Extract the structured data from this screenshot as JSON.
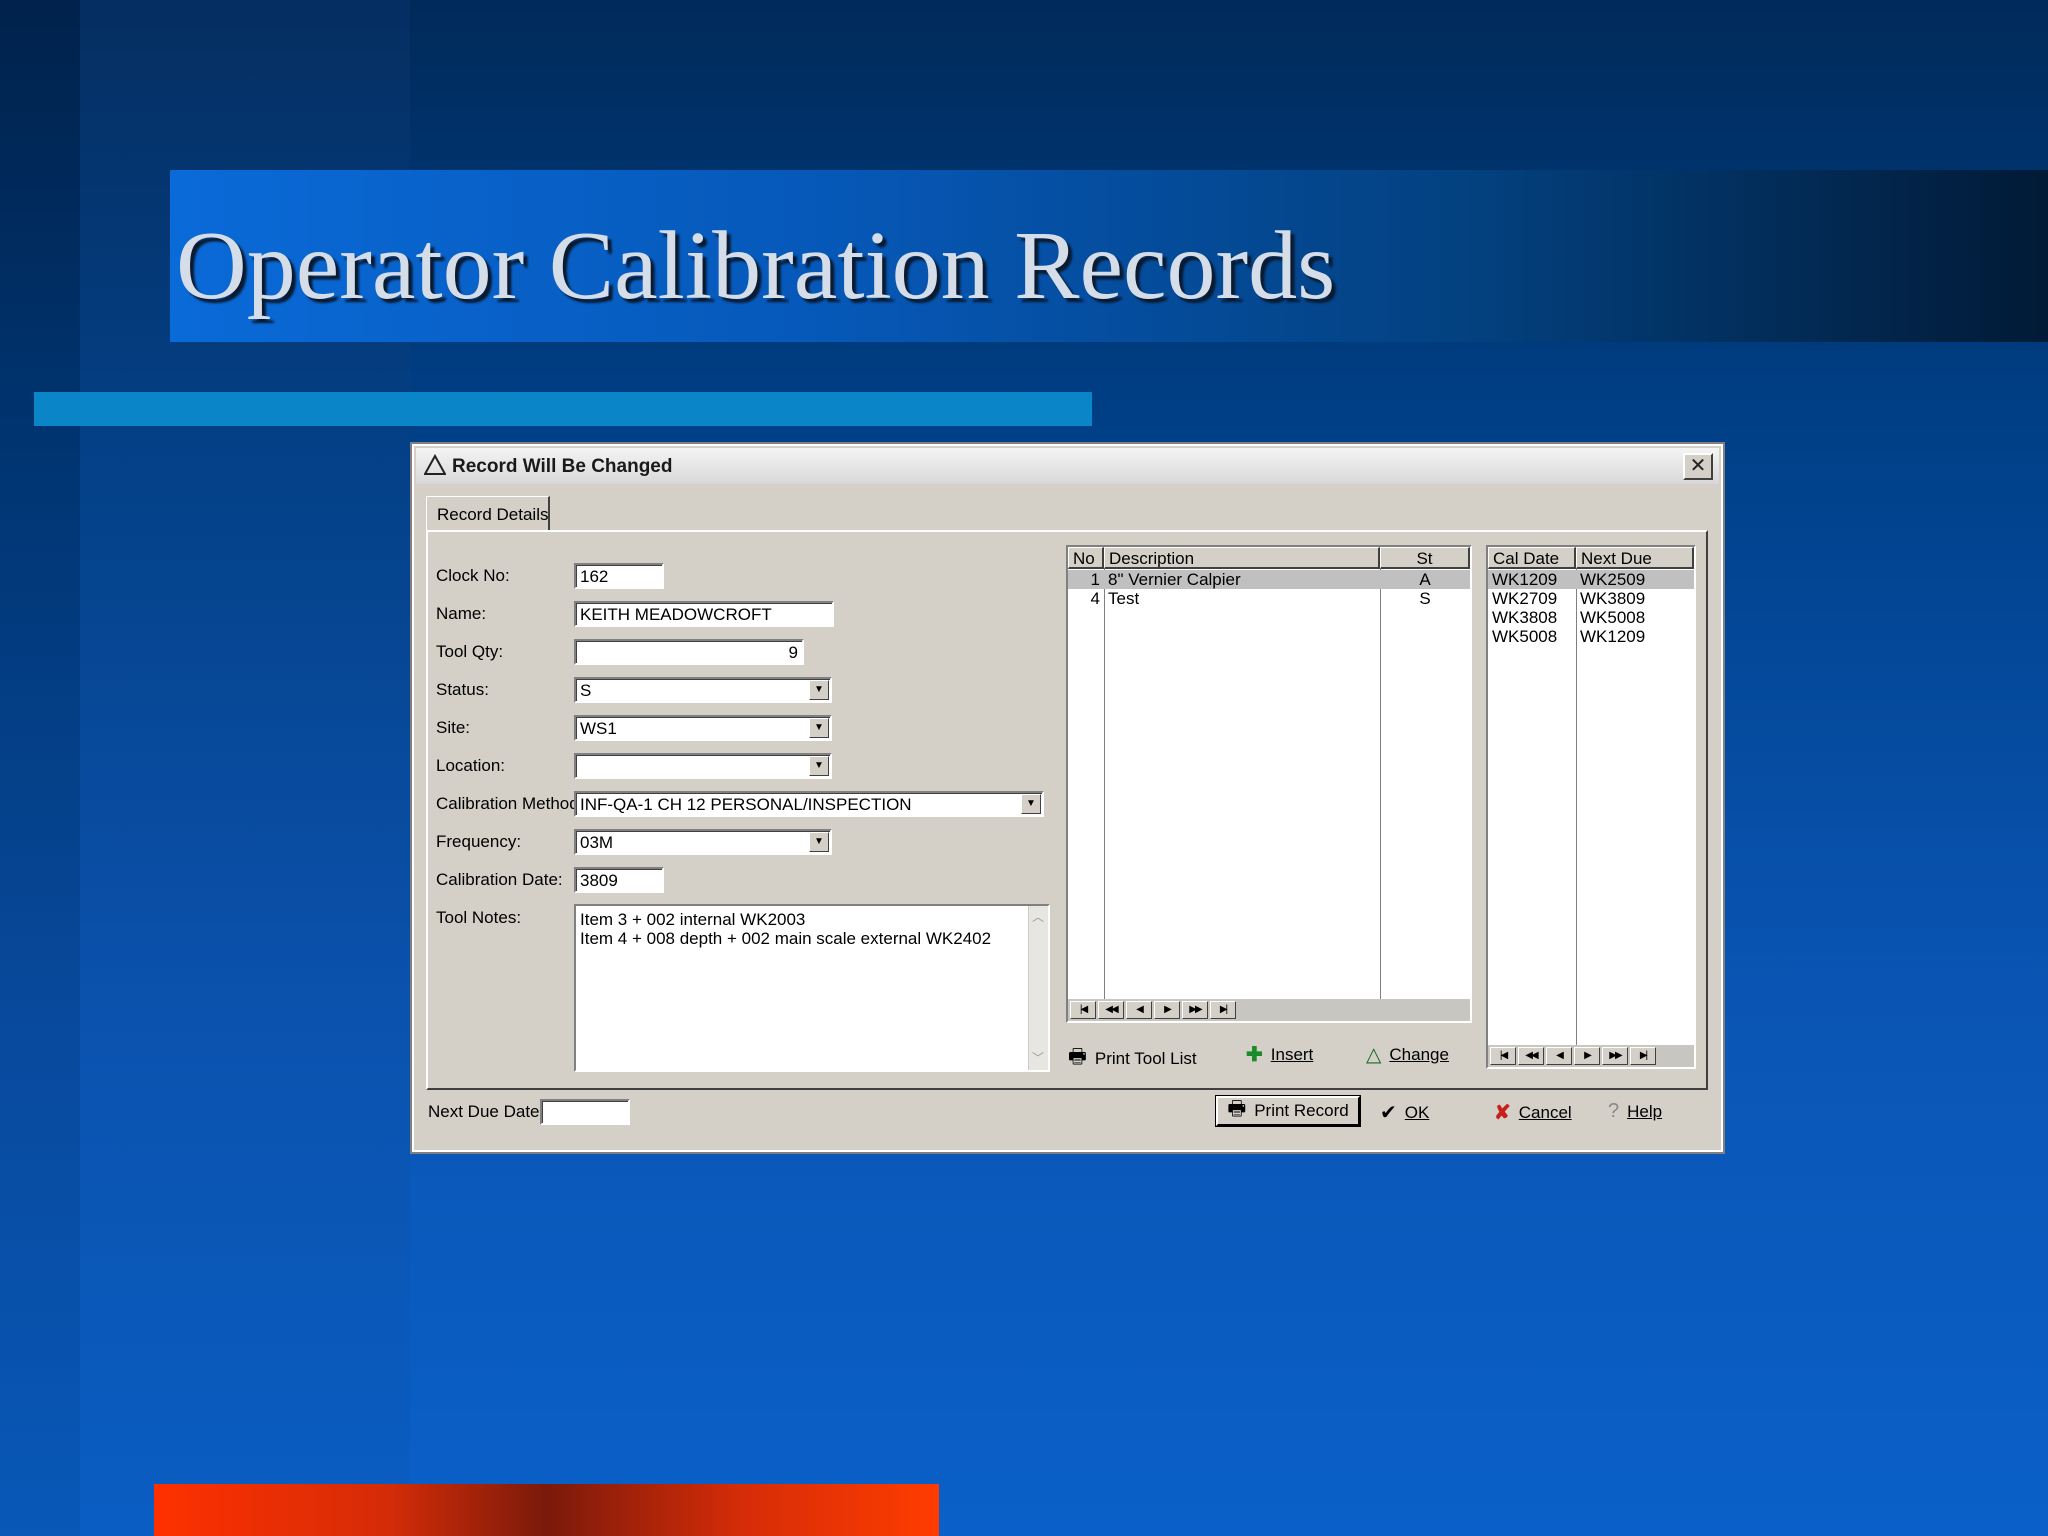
{
  "slide": {
    "title": "Operator Calibration Records"
  },
  "dialog": {
    "title": "Record Will Be Changed",
    "tab_label": "Record Details",
    "fields": {
      "clock_no": {
        "label": "Clock No:",
        "value": "162"
      },
      "name": {
        "label": "Name:",
        "value": "KEITH MEADOWCROFT"
      },
      "tool_qty": {
        "label": "Tool Qty:",
        "value": "9"
      },
      "status": {
        "label": "Status:",
        "value": "S"
      },
      "site": {
        "label": "Site:",
        "value": "WS1"
      },
      "location": {
        "label": "Location:",
        "value": ""
      },
      "calibration_method": {
        "label": "Calibration Method:",
        "value": "INF-QA-1 CH 12 PERSONAL/INSPECTION"
      },
      "frequency": {
        "label": "Frequency:",
        "value": "03M"
      },
      "calibration_date": {
        "label": "Calibration Date:",
        "value": "3809"
      },
      "tool_notes": {
        "label": "Tool Notes:",
        "lines": [
          "Item 3 + 002 internal WK2003",
          "Item 4 + 008 depth + 002 main scale external WK2402"
        ]
      },
      "next_due_date": {
        "label": "Next Due Date:",
        "value": ""
      }
    },
    "tool_grid": {
      "headers": [
        "No",
        "Description",
        "St"
      ],
      "rows": [
        {
          "no": "1",
          "description": "8\" Vernier Calpier",
          "st": "A",
          "selected": true
        },
        {
          "no": "4",
          "description": "Test",
          "st": "S",
          "selected": false
        }
      ]
    },
    "cal_grid": {
      "headers": [
        "Cal Date",
        "Next Due"
      ],
      "rows": [
        {
          "cal_date": "WK1209",
          "next_due": "WK2509",
          "selected": true
        },
        {
          "cal_date": "WK2709",
          "next_due": "WK3809",
          "selected": false
        },
        {
          "cal_date": "WK3808",
          "next_due": "WK5008",
          "selected": false
        },
        {
          "cal_date": "WK5008",
          "next_due": "WK1209",
          "selected": false
        }
      ]
    },
    "buttons": {
      "print_tool_list": "Print Tool List",
      "insert": "Insert",
      "change": "Change",
      "print_record": "Print Record",
      "ok": "OK",
      "cancel": "Cancel",
      "help": "Help"
    },
    "colors": {
      "accent": "#0a86c8",
      "selection": "#c0c0c0",
      "cancel_icon": "#c81e1e",
      "insert_icon": "#1a8a2a"
    }
  }
}
